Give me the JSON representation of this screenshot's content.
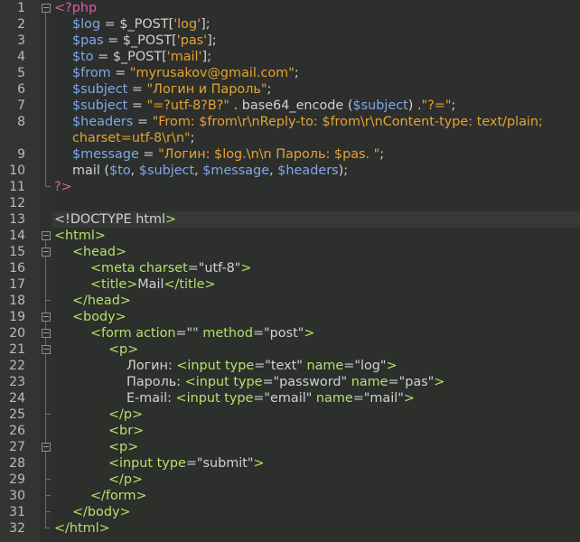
{
  "editor": {
    "line_numbers": [
      "1",
      "2",
      "3",
      "4",
      "5",
      "6",
      "7",
      "8",
      "",
      "9",
      "10",
      "11",
      "12",
      "13",
      "14",
      "15",
      "16",
      "17",
      "18",
      "19",
      "20",
      "21",
      "22",
      "23",
      "24",
      "25",
      "26",
      "27",
      "28",
      "29",
      "30",
      "31",
      "32"
    ],
    "colors": {
      "background": "#2c2f2c",
      "tag": "#b6e06a",
      "php_delimiter": "#e05aa6",
      "variable": "#7fa8e8",
      "string": "#e7a233",
      "text": "#cfd3cd"
    },
    "lines": [
      {
        "indent": 0,
        "tokens": [
          {
            "c": "php",
            "t": "<?php"
          }
        ]
      },
      {
        "indent": 1,
        "tokens": [
          {
            "c": "var",
            "t": "$log"
          },
          {
            "c": "txt",
            "t": " = "
          },
          {
            "c": "txt",
            "t": "$_POST["
          },
          {
            "c": "str",
            "t": "'log'"
          },
          {
            "c": "txt",
            "t": "];"
          }
        ]
      },
      {
        "indent": 1,
        "tokens": [
          {
            "c": "var",
            "t": "$pas"
          },
          {
            "c": "txt",
            "t": " = "
          },
          {
            "c": "txt",
            "t": "$_POST["
          },
          {
            "c": "str",
            "t": "'pas'"
          },
          {
            "c": "txt",
            "t": "];"
          }
        ]
      },
      {
        "indent": 1,
        "tokens": [
          {
            "c": "var",
            "t": "$to"
          },
          {
            "c": "txt",
            "t": " = "
          },
          {
            "c": "txt",
            "t": "$_POST["
          },
          {
            "c": "str",
            "t": "'mail'"
          },
          {
            "c": "txt",
            "t": "];"
          }
        ]
      },
      {
        "indent": 1,
        "tokens": [
          {
            "c": "var",
            "t": "$from"
          },
          {
            "c": "txt",
            "t": " = "
          },
          {
            "c": "str",
            "t": "\"myrusakov@gmail.com\""
          },
          {
            "c": "txt",
            "t": ";"
          }
        ]
      },
      {
        "indent": 1,
        "tokens": [
          {
            "c": "var",
            "t": "$subject"
          },
          {
            "c": "txt",
            "t": " = "
          },
          {
            "c": "str",
            "t": "\"Логин и Пароль\""
          },
          {
            "c": "txt",
            "t": ";"
          }
        ]
      },
      {
        "indent": 1,
        "tokens": [
          {
            "c": "var",
            "t": "$subject"
          },
          {
            "c": "txt",
            "t": " = "
          },
          {
            "c": "str",
            "t": "\"=?utf-8?B?\""
          },
          {
            "c": "txt",
            "t": " . base64_encode ("
          },
          {
            "c": "var",
            "t": "$subject"
          },
          {
            "c": "txt",
            "t": ") ."
          },
          {
            "c": "str",
            "t": "\"?=\""
          },
          {
            "c": "txt",
            "t": ";"
          }
        ]
      },
      {
        "indent": 1,
        "tokens": [
          {
            "c": "var",
            "t": "$headers"
          },
          {
            "c": "txt",
            "t": " = "
          },
          {
            "c": "str",
            "t": "\"From: $from\\r\\nReply-to: $from\\r\\nContent-type: text/plain;"
          }
        ]
      },
      {
        "indent": 1,
        "tokens": [
          {
            "c": "str",
            "t": "charset=utf-8\\r\\n\""
          },
          {
            "c": "txt",
            "t": ";"
          }
        ]
      },
      {
        "indent": 1,
        "tokens": [
          {
            "c": "var",
            "t": "$message"
          },
          {
            "c": "txt",
            "t": " = "
          },
          {
            "c": "str",
            "t": "\"Логин: $log.\\n\\n Пароль: $pas. \""
          },
          {
            "c": "txt",
            "t": ";"
          }
        ]
      },
      {
        "indent": 1,
        "tokens": [
          {
            "c": "txt",
            "t": "mail ("
          },
          {
            "c": "var",
            "t": "$to"
          },
          {
            "c": "txt",
            "t": ", "
          },
          {
            "c": "var",
            "t": "$subject"
          },
          {
            "c": "txt",
            "t": ", "
          },
          {
            "c": "var",
            "t": "$message"
          },
          {
            "c": "txt",
            "t": ", "
          },
          {
            "c": "var",
            "t": "$headers"
          },
          {
            "c": "txt",
            "t": ");"
          }
        ]
      },
      {
        "indent": 0,
        "tokens": [
          {
            "c": "php",
            "t": "?>"
          }
        ]
      },
      {
        "indent": 0,
        "tokens": []
      },
      {
        "indent": 0,
        "tokens": [
          {
            "c": "txt",
            "t": "<!DOCTYPE html"
          },
          {
            "c": "tag",
            "t": ">"
          }
        ]
      },
      {
        "indent": 0,
        "tokens": [
          {
            "c": "tag",
            "t": "<html>"
          }
        ]
      },
      {
        "indent": 1,
        "tokens": [
          {
            "c": "tag",
            "t": "<head>"
          }
        ]
      },
      {
        "indent": 2,
        "tokens": [
          {
            "c": "tag",
            "t": "<meta"
          },
          {
            "c": "txt",
            "t": " "
          },
          {
            "c": "attr",
            "t": "charset"
          },
          {
            "c": "txt",
            "t": "=\"utf-8\""
          },
          {
            "c": "tag",
            "t": ">"
          }
        ]
      },
      {
        "indent": 2,
        "tokens": [
          {
            "c": "tag",
            "t": "<title>"
          },
          {
            "c": "txt",
            "t": "Mail"
          },
          {
            "c": "tag",
            "t": "</title>"
          }
        ]
      },
      {
        "indent": 1,
        "tokens": [
          {
            "c": "tag",
            "t": "</head>"
          }
        ]
      },
      {
        "indent": 1,
        "tokens": [
          {
            "c": "tag",
            "t": "<body>"
          }
        ]
      },
      {
        "indent": 2,
        "tokens": [
          {
            "c": "tag",
            "t": "<form"
          },
          {
            "c": "txt",
            "t": " "
          },
          {
            "c": "attr",
            "t": "action"
          },
          {
            "c": "txt",
            "t": "=\"\" "
          },
          {
            "c": "attr",
            "t": "method"
          },
          {
            "c": "txt",
            "t": "=\"post\""
          },
          {
            "c": "tag",
            "t": ">"
          }
        ]
      },
      {
        "indent": 3,
        "tokens": [
          {
            "c": "tag",
            "t": "<p>"
          }
        ]
      },
      {
        "indent": 4,
        "tokens": [
          {
            "c": "txt",
            "t": "Логин: "
          },
          {
            "c": "tag",
            "t": "<input"
          },
          {
            "c": "txt",
            "t": " "
          },
          {
            "c": "attr",
            "t": "type"
          },
          {
            "c": "txt",
            "t": "=\"text\" "
          },
          {
            "c": "attr",
            "t": "name"
          },
          {
            "c": "txt",
            "t": "=\"log\""
          },
          {
            "c": "tag",
            "t": ">"
          }
        ]
      },
      {
        "indent": 4,
        "tokens": [
          {
            "c": "txt",
            "t": "Пароль: "
          },
          {
            "c": "tag",
            "t": "<input"
          },
          {
            "c": "txt",
            "t": " "
          },
          {
            "c": "attr",
            "t": "type"
          },
          {
            "c": "txt",
            "t": "=\"password\" "
          },
          {
            "c": "attr",
            "t": "name"
          },
          {
            "c": "txt",
            "t": "=\"pas\""
          },
          {
            "c": "tag",
            "t": ">"
          }
        ]
      },
      {
        "indent": 4,
        "tokens": [
          {
            "c": "txt",
            "t": "E-mail: "
          },
          {
            "c": "tag",
            "t": "<input"
          },
          {
            "c": "txt",
            "t": " "
          },
          {
            "c": "attr",
            "t": "type"
          },
          {
            "c": "txt",
            "t": "=\"email\" "
          },
          {
            "c": "attr",
            "t": "name"
          },
          {
            "c": "txt",
            "t": "=\"mail\""
          },
          {
            "c": "tag",
            "t": ">"
          }
        ]
      },
      {
        "indent": 3,
        "tokens": [
          {
            "c": "tag",
            "t": "</p>"
          }
        ]
      },
      {
        "indent": 3,
        "tokens": [
          {
            "c": "tag",
            "t": "<br>"
          }
        ]
      },
      {
        "indent": 3,
        "tokens": [
          {
            "c": "tag",
            "t": "<p>"
          }
        ]
      },
      {
        "indent": 3,
        "tokens": [
          {
            "c": "tag",
            "t": "<input"
          },
          {
            "c": "txt",
            "t": " "
          },
          {
            "c": "attr",
            "t": "type"
          },
          {
            "c": "txt",
            "t": "=\"submit\""
          },
          {
            "c": "tag",
            "t": ">"
          }
        ]
      },
      {
        "indent": 3,
        "tokens": [
          {
            "c": "tag",
            "t": "</p>"
          }
        ]
      },
      {
        "indent": 2,
        "tokens": [
          {
            "c": "tag",
            "t": "</form>"
          }
        ]
      },
      {
        "indent": 1,
        "tokens": [
          {
            "c": "tag",
            "t": "</body>"
          }
        ]
      },
      {
        "indent": 0,
        "tokens": [
          {
            "c": "tag",
            "t": "</html>"
          }
        ]
      }
    ],
    "folds": [
      {
        "start": 0,
        "end": 11
      },
      {
        "start": 14,
        "end": 32
      },
      {
        "start": 15,
        "end": 18
      },
      {
        "start": 19,
        "end": 31
      },
      {
        "start": 20,
        "end": 30
      },
      {
        "start": 21,
        "end": 25
      },
      {
        "start": 27,
        "end": 29
      }
    ],
    "highlighted_row": 13
  }
}
